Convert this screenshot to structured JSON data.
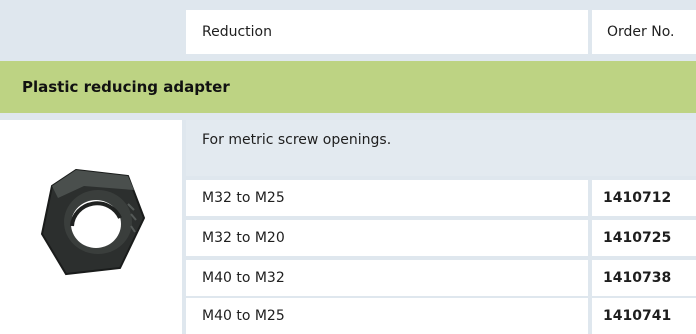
{
  "table": {
    "header": {
      "reduction": "Reduction",
      "order_no": "Order No."
    },
    "section_title": "Plastic reducing adapter",
    "description": "For metric screw openings.",
    "rows": [
      {
        "reduction": "M32 to M25",
        "order_no": "1410712"
      },
      {
        "reduction": "M32 to M20",
        "order_no": "1410725"
      },
      {
        "reduction": "M40 to M32",
        "order_no": "1410738"
      },
      {
        "reduction": "M40 to M25",
        "order_no": "1410741"
      }
    ]
  },
  "product_image": {
    "icon": "hex-reducing-adapter-icon",
    "color": "#2c2f2e"
  },
  "colors": {
    "background": "#dfe7ee",
    "section_band": "#bdd383",
    "description_row": "#e3eaf0",
    "cell": "#ffffff"
  }
}
